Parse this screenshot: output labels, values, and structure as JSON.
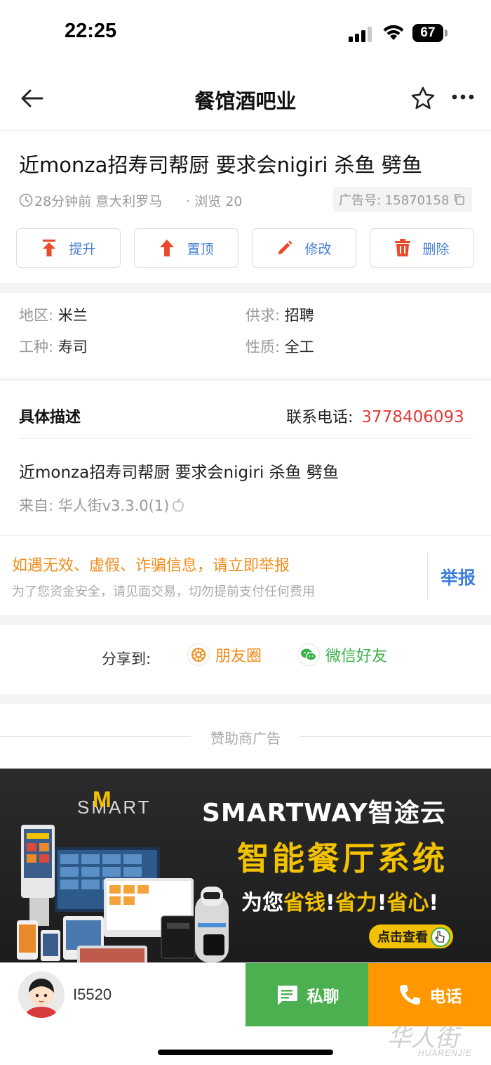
{
  "status_bar": {
    "time": "22:25",
    "battery": "67"
  },
  "nav": {
    "title": "餐馆酒吧业"
  },
  "ad": {
    "title": "近monza招寿司帮厨 要求会nigiri 杀鱼 劈鱼",
    "posted": "28分钟前 意大利罗马",
    "views": "· 浏览 20",
    "ad_number": "广告号: 15870158"
  },
  "actions": [
    {
      "label": "提升",
      "icon": "promote-icon"
    },
    {
      "label": "置顶",
      "icon": "pin-top-icon"
    },
    {
      "label": "修改",
      "icon": "edit-icon"
    },
    {
      "label": "删除",
      "icon": "delete-icon"
    }
  ],
  "info": {
    "region_key": "地区: ",
    "region_val": "米兰",
    "supply_key": "供求: ",
    "supply_val": "招聘",
    "job_key": "工种: ",
    "job_val": "寿司",
    "nature_key": "性质: ",
    "nature_val": "全工"
  },
  "description": {
    "heading": "具体描述",
    "phone_label": "联系电话:",
    "phone": "3778406093",
    "text": "近monza招寿司帮厨 要求会nigiri 杀鱼 劈鱼",
    "source": "来自: 华人街v3.3.0(1)"
  },
  "warning": {
    "title": "如遇无效、虚假、诈骗信息，请立即举报",
    "subtitle": "为了您资金安全，请见面交易，切勿提前支付任何费用",
    "report": "举报"
  },
  "share": {
    "label": "分享到:",
    "moments": "朋友圈",
    "wechat": "微信好友"
  },
  "sponsor": {
    "label": "赞助商广告",
    "logo_text": "SMART",
    "logo_m": "M",
    "brand": "SMARTWAY智途云",
    "headline": "智能餐厅系统",
    "slogan_pre": "为您",
    "slogan_hl1": "省钱",
    "slogan_mid1": "!",
    "slogan_hl2": "省力",
    "slogan_mid2": "!",
    "slogan_hl3": "省心",
    "slogan_end": "!",
    "cta": "点击查看"
  },
  "bottom": {
    "username": "I5520",
    "chat": "私聊",
    "call": "电话"
  },
  "watermark": {
    "main": "华人街",
    "sub": "HUARENJIE"
  },
  "colors": {
    "accent_blue": "#4a7fd4",
    "phone_red": "#e23a3a",
    "warning_orange": "#f08c1a",
    "chat_green": "#4caf50",
    "call_orange": "#ff9800",
    "banner_yellow": "#f2c100"
  }
}
